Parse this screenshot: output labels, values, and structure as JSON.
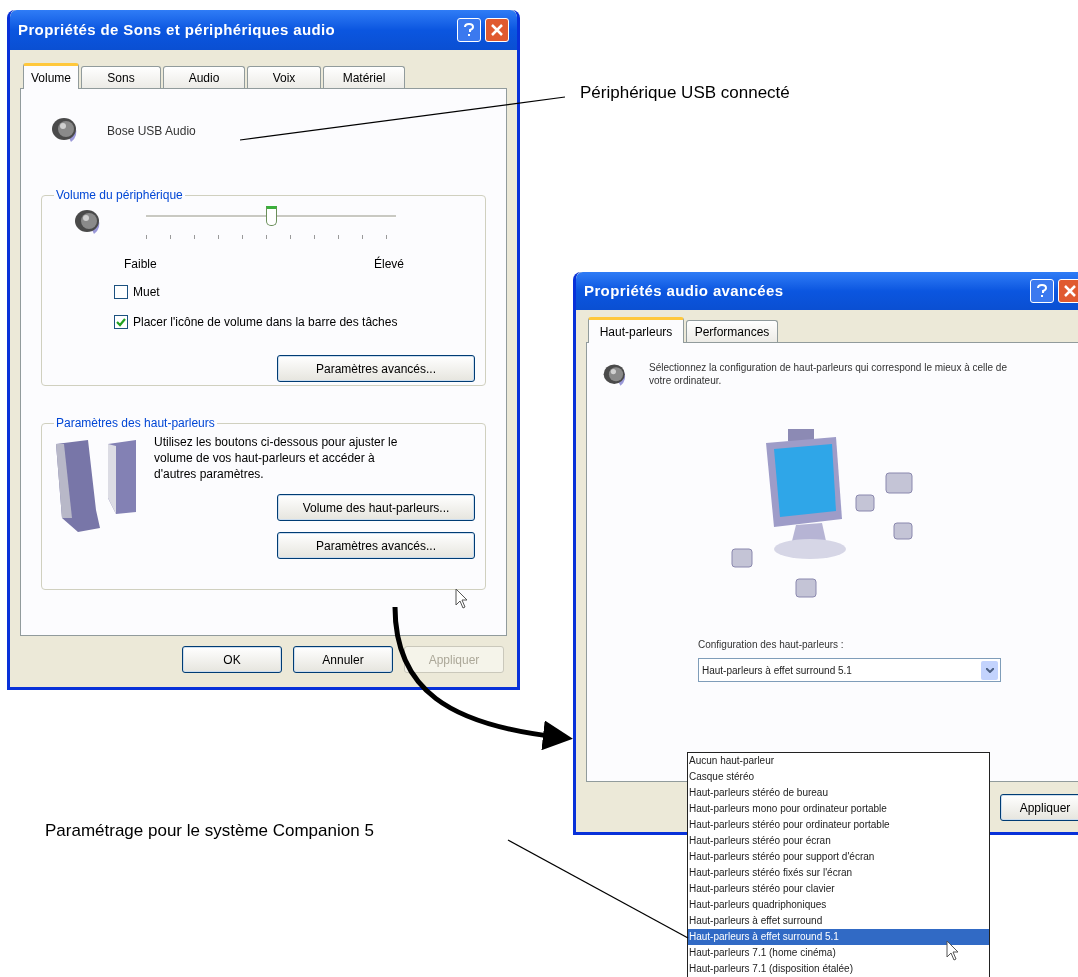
{
  "callouts": [
    {
      "text": "Périphérique USB connecté"
    },
    {
      "text": "Paramétrage pour le système Companion 5"
    }
  ],
  "sound_dialog": {
    "title": "Propriétés de Sons et périphériques audio",
    "tabs": [
      {
        "label": "Volume",
        "selected": true
      },
      {
        "label": "Sons",
        "selected": false
      },
      {
        "label": "Audio",
        "selected": false
      },
      {
        "label": "Voix",
        "selected": false
      },
      {
        "label": "Matériel",
        "selected": false
      }
    ],
    "device_name": "Bose USB Audio",
    "volume_group": {
      "title": "Volume du périphérique",
      "level": 0.5,
      "min_label": "Faible",
      "max_label": "Élevé",
      "checkboxes": [
        {
          "label": "Muet",
          "checked": false
        },
        {
          "label": "Placer l'icône de volume dans la barre des tâches",
          "checked": true
        }
      ],
      "button": "Paramètres avancés..."
    },
    "speaker_group": {
      "title": "Paramètres des haut-parleurs",
      "description": "Utilisez les boutons ci-dessous pour ajuster le volume de vos haut-parleurs et accéder à d'autres paramètres.",
      "buttons": [
        {
          "label": "Volume des haut-parleurs..."
        },
        {
          "label": "Paramètres avancés..."
        }
      ]
    },
    "buttons": [
      {
        "label": "OK",
        "disabled": false
      },
      {
        "label": "Annuler",
        "disabled": false
      },
      {
        "label": "Appliquer",
        "disabled": true
      }
    ]
  },
  "advanced_dialog": {
    "title": "Propriétés audio avancées",
    "tabs": [
      {
        "label": "Haut-parleurs",
        "selected": true
      },
      {
        "label": "Performances",
        "selected": false
      }
    ],
    "description": "Sélectionnez la configuration de haut-parleurs qui correspond le mieux à celle de votre ordinateur.",
    "config_label": "Configuration des haut-parleurs :",
    "config_value": "Haut-parleurs à effet surround 5.1",
    "options": [
      {
        "label": "Aucun haut-parleur",
        "selected": false
      },
      {
        "label": "Casque stéréo",
        "selected": false
      },
      {
        "label": "Haut-parleurs stéréo de bureau",
        "selected": false
      },
      {
        "label": "Haut-parleurs mono pour ordinateur portable",
        "selected": false
      },
      {
        "label": "Haut-parleurs stéréo pour ordinateur portable",
        "selected": false
      },
      {
        "label": "Haut-parleurs stéréo pour écran",
        "selected": false
      },
      {
        "label": "Haut-parleurs stéréo pour support d'écran",
        "selected": false
      },
      {
        "label": "Haut-parleurs stéréo fixés sur l'écran",
        "selected": false
      },
      {
        "label": "Haut-parleurs stéréo pour clavier",
        "selected": false
      },
      {
        "label": "Haut-parleurs quadriphoniques",
        "selected": false
      },
      {
        "label": "Haut-parleurs à effet surround",
        "selected": false
      },
      {
        "label": "Haut-parleurs à effet surround 5.1",
        "selected": true
      },
      {
        "label": "Haut-parleurs 7.1 (home cinéma)",
        "selected": false
      },
      {
        "label": "Haut-parleurs 7.1 (disposition étalée)",
        "selected": false
      }
    ],
    "buttons": [
      "Appliquer"
    ]
  }
}
